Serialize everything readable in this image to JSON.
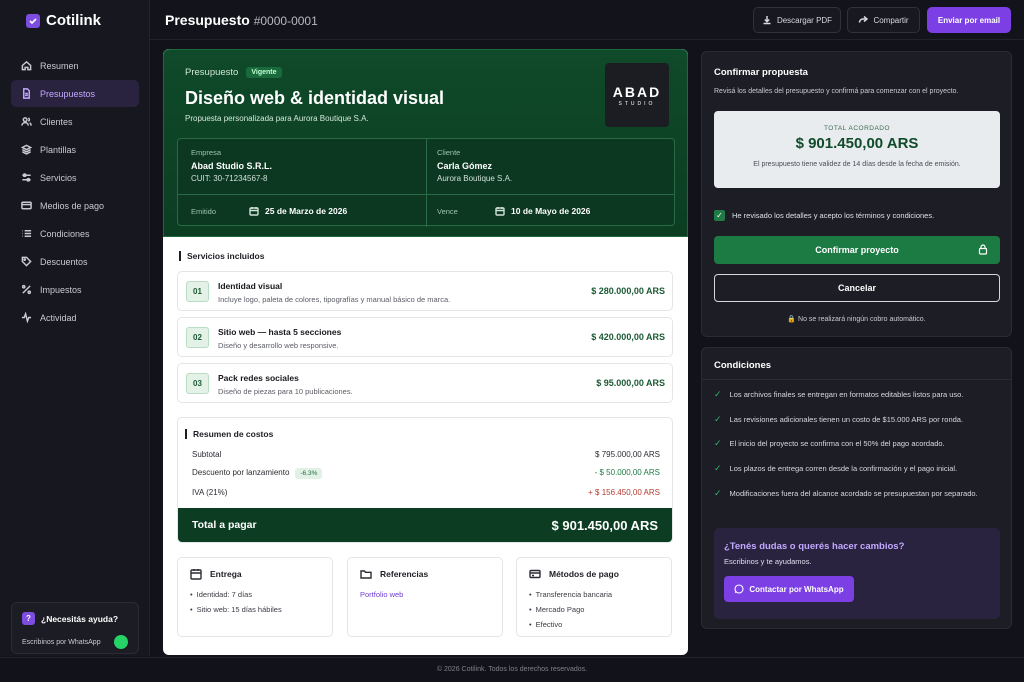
{
  "app": {
    "name": "Cotilink"
  },
  "sidebar": {
    "items": [
      {
        "label": "Resumen",
        "icon": "home-icon"
      },
      {
        "label": "Presupuestos",
        "icon": "document-icon",
        "active": true
      },
      {
        "label": "Clientes",
        "icon": "users-icon"
      },
      {
        "label": "Plantillas",
        "icon": "layers-icon"
      },
      {
        "label": "Servicios",
        "icon": "sliders-icon"
      },
      {
        "label": "Medios de pago",
        "icon": "card-icon"
      },
      {
        "label": "Condiciones",
        "icon": "list-icon"
      },
      {
        "label": "Descuentos",
        "icon": "tag-icon"
      },
      {
        "label": "Impuestos",
        "icon": "percent-icon"
      },
      {
        "label": "Actividad",
        "icon": "activity-icon"
      }
    ],
    "help": {
      "title": "¿Necesitás ayuda?",
      "subtitle": "Escribinos por WhatsApp"
    }
  },
  "header": {
    "title": "Presupuesto",
    "number": "#0000-0001",
    "download_label": "Descargar PDF",
    "share_label": "Compartir",
    "send_label": "Enviar por email"
  },
  "quote": {
    "label": "Presupuesto",
    "status": "Vigente",
    "title": "Diseño web & identidad visual",
    "subtitle": "Propuesta personalizada para Aurora Boutique S.A.",
    "logo_big": "ABAD",
    "logo_small": "STUDIO",
    "company": {
      "label": "Empresa",
      "name": "Abad Studio S.R.L.",
      "cuit": "CUIT: 30-71234567-8"
    },
    "client": {
      "label": "Cliente",
      "name": "Carla Gómez",
      "company": "Aurora Boutique S.A."
    },
    "issued": {
      "label": "Emitido",
      "date": "25 de Marzo de 2026"
    },
    "due": {
      "label": "Vence",
      "date": "10 de Mayo de 2026"
    }
  },
  "services": {
    "title": "Servicios incluidos",
    "items": [
      {
        "num": "01",
        "name": "Identidad visual",
        "desc": "Incluye logo, paleta de colores, tipografías y manual básico de marca.",
        "price": "$ 280.000,00 ARS"
      },
      {
        "num": "02",
        "name": "Sitio web — hasta 5 secciones",
        "desc": "Diseño y desarrollo web responsive.",
        "price": "$ 420.000,00 ARS"
      },
      {
        "num": "03",
        "name": "Pack redes sociales",
        "desc": "Diseño de piezas para 10 publicaciones.",
        "price": "$ 95.000,00 ARS"
      }
    ]
  },
  "costs": {
    "title": "Resumen de costos",
    "subtotal_label": "Subtotal",
    "subtotal": "$ 795.000,00 ARS",
    "discount_label": "Descuento por lanzamiento",
    "discount_badge": "-6.3%",
    "discount": "- $ 50.000,00 ARS",
    "tax_label": "IVA (21%)",
    "tax": "+ $ 156.450,00 ARS",
    "total_label": "Total a pagar",
    "total": "$ 901.450,00 ARS"
  },
  "boxes": {
    "delivery": {
      "title": "Entrega",
      "items": [
        "Identidad: 7 días",
        "Sitio web: 15 días hábiles"
      ]
    },
    "refs": {
      "title": "Referencias",
      "link": "Portfolio web"
    },
    "payments": {
      "title": "Métodos de pago",
      "items": [
        "Transferencia bancaria",
        "Mercado Pago",
        "Efectivo"
      ]
    }
  },
  "confirm": {
    "title": "Confirmar propuesta",
    "subtitle": "Revisá los detalles del presupuesto y confirmá para comenzar con el proyecto.",
    "total_label": "TOTAL ACORDADO",
    "total": "$ 901.450,00 ARS",
    "validity": "El presupuesto tiene validez de 14 días desde la fecha de emisión.",
    "checkbox_label": "He revisado los detalles y acepto los términos y condiciones.",
    "confirm_label": "Confirmar proyecto",
    "cancel_label": "Cancelar",
    "no_charge": "No se realizará ningún cobro automático."
  },
  "conditions": {
    "title": "Condiciones",
    "items": [
      "Los archivos finales se entregan en formatos editables listos para uso.",
      "Las revisiones adicionales tienen un costo de $15.000 ARS por ronda.",
      "El inicio del proyecto se confirma con el 50% del pago acordado.",
      "Los plazos de entrega corren desde la confirmación y el pago inicial.",
      "Modificaciones fuera del alcance acordado se presupuestan por separado."
    ],
    "help_title": "¿Tenés dudas o querés hacer cambios?",
    "help_sub": "Escribinos y te ayudamos.",
    "whatsapp_label": "Contactar por WhatsApp"
  },
  "footer": {
    "text": "© 2026 Cotilink. Todos los derechos reservados."
  }
}
